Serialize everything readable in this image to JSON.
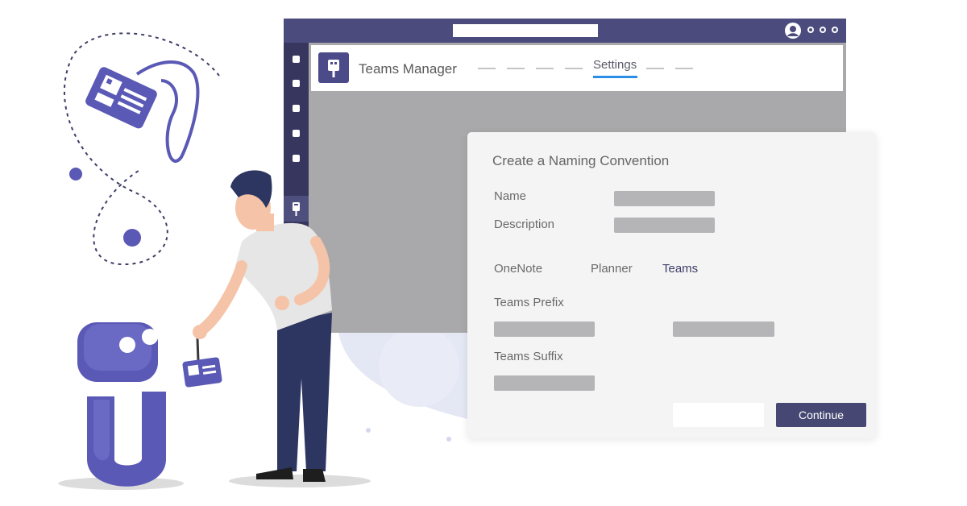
{
  "window": {
    "app_name": "Teams Manager",
    "active_tab": "Settings",
    "rail_icons": [
      "app-icon",
      "app-icon",
      "app-icon",
      "app-icon",
      "app-icon",
      "badge-icon"
    ],
    "title_icons": [
      "avatar-icon",
      "more-dots-icon"
    ]
  },
  "dialog": {
    "title": "Create a Naming Convention",
    "name_label": "Name",
    "description_label": "Description",
    "tabs": [
      "OneNote",
      "Planner",
      "Teams"
    ],
    "active_tab": "Teams",
    "prefix_label": "Teams Prefix",
    "suffix_label": "Teams Suffix",
    "continue_label": "Continue"
  },
  "colors": {
    "brand": "#4b4b7e",
    "accent": "#5a59b5",
    "tab_underline": "#2b8ee6"
  }
}
